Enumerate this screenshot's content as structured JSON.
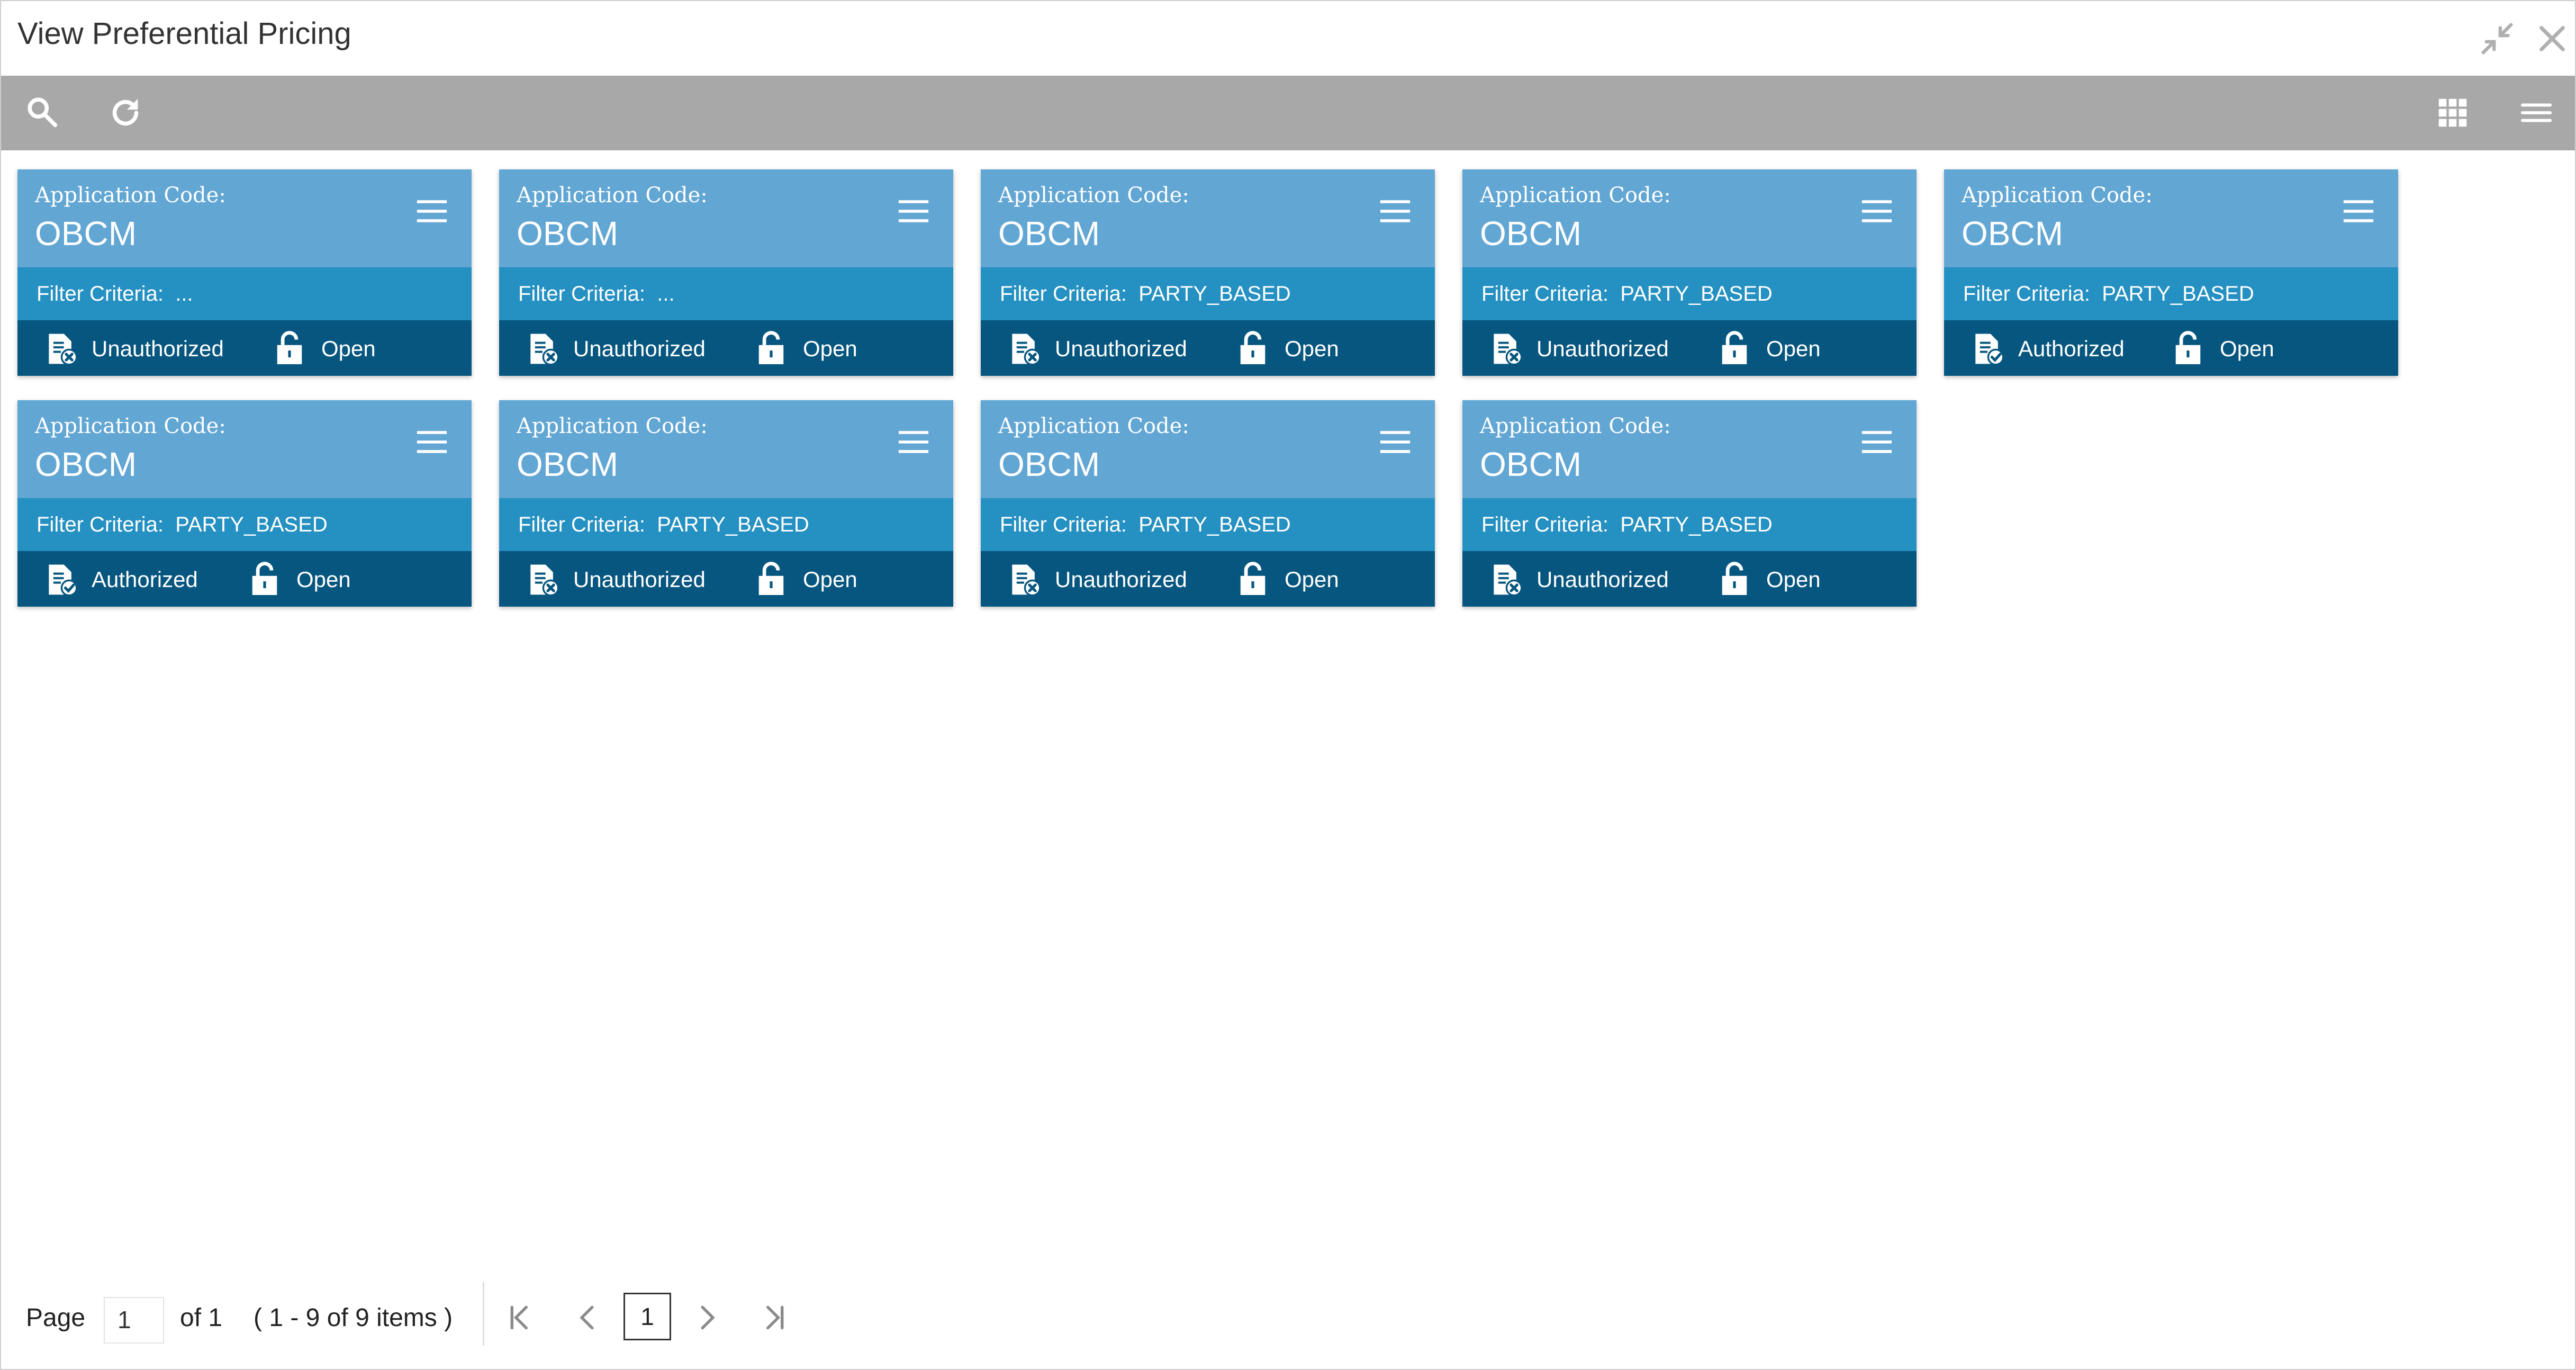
{
  "window": {
    "title": "View Preferential Pricing",
    "icons": [
      "minimize-icon",
      "close-icon"
    ]
  },
  "toolbar": {
    "left_icons": [
      "search-icon",
      "refresh-icon"
    ],
    "right_icons": [
      "grid-view-icon",
      "list-view-icon"
    ],
    "color": "#a8a8a8"
  },
  "cards": [
    {
      "app_label": "Application Code:",
      "app_code": "OBCM",
      "filter": "Filter Criteria:  ...",
      "status": "Unauthorized",
      "status_icon": "document-x-icon",
      "lock": "Open"
    },
    {
      "app_label": "Application Code:",
      "app_code": "OBCM",
      "filter": "Filter Criteria:  ...",
      "status": "Unauthorized",
      "status_icon": "document-x-icon",
      "lock": "Open"
    },
    {
      "app_label": "Application Code:",
      "app_code": "OBCM",
      "filter": "Filter Criteria:  PARTY_BASED",
      "status": "Unauthorized",
      "status_icon": "document-x-icon",
      "lock": "Open"
    },
    {
      "app_label": "Application Code:",
      "app_code": "OBCM",
      "filter": "Filter Criteria:  PARTY_BASED",
      "status": "Unauthorized",
      "status_icon": "document-x-icon",
      "lock": "Open"
    },
    {
      "app_label": "Application Code:",
      "app_code": "OBCM",
      "filter": "Filter Criteria:  PARTY_BASED",
      "status": "Authorized",
      "status_icon": "document-check-icon",
      "lock": "Open"
    },
    {
      "app_label": "Application Code:",
      "app_code": "OBCM",
      "filter": "Filter Criteria:  PARTY_BASED",
      "status": "Authorized",
      "status_icon": "document-check-icon",
      "lock": "Open"
    },
    {
      "app_label": "Application Code:",
      "app_code": "OBCM",
      "filter": "Filter Criteria:  PARTY_BASED",
      "status": "Unauthorized",
      "status_icon": "document-x-icon",
      "lock": "Open"
    },
    {
      "app_label": "Application Code:",
      "app_code": "OBCM",
      "filter": "Filter Criteria:  PARTY_BASED",
      "status": "Unauthorized",
      "status_icon": "document-x-icon",
      "lock": "Open"
    },
    {
      "app_label": "Application Code:",
      "app_code": "OBCM",
      "filter": "Filter Criteria:  PARTY_BASED",
      "status": "Unauthorized",
      "status_icon": "document-x-icon",
      "lock": "Open"
    }
  ],
  "colors": {
    "card_top": "#62a6d4",
    "card_mid": "#2590c2",
    "card_bottom": "#07567f"
  },
  "pager": {
    "page_label": "Page",
    "page_value": "1",
    "of_label": "of 1",
    "items_label": "( 1 - 9 of 9 items )",
    "current_page": "1",
    "nav_icons": [
      "first-page-icon",
      "previous-page-icon",
      "next-page-icon",
      "last-page-icon"
    ]
  }
}
